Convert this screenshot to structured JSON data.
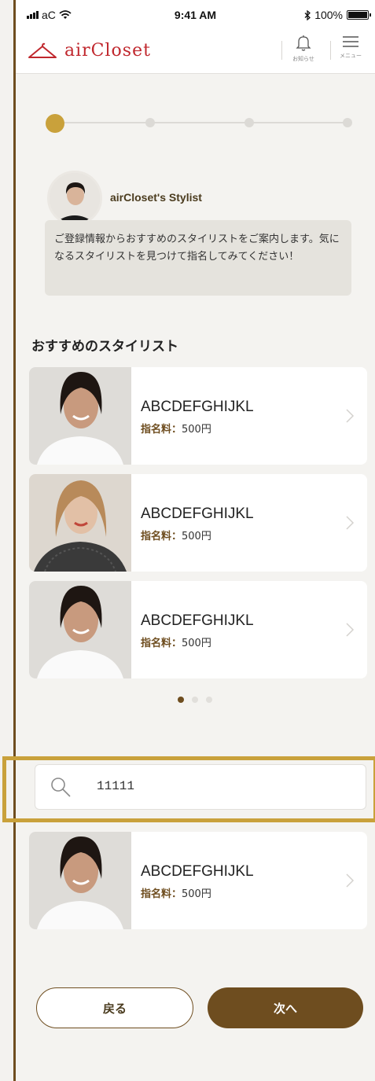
{
  "status_bar": {
    "carrier": "aC",
    "time": "9:41 AM",
    "battery": "100%"
  },
  "header": {
    "logo_text": "airCloset",
    "notifications_label": "お知らせ",
    "menu_label": "メニュー"
  },
  "progress": {
    "current_step": 1,
    "total_steps": 4
  },
  "stylist_intro": {
    "name": "airCloset's Stylist",
    "message": "ご登録情報からおすすめのスタイリストをご案内します。気になるスタイリストを見つけて指名してみてください！"
  },
  "recommended": {
    "title": "おすすめのスタイリスト",
    "stylists": [
      {
        "name": "ABCDEFGHIJKL",
        "fee_label": "指名料：",
        "fee_value": "500円"
      },
      {
        "name": "ABCDEFGHIJKL",
        "fee_label": "指名料：",
        "fee_value": "500円"
      },
      {
        "name": "ABCDEFGHIJKL",
        "fee_label": "指名料：",
        "fee_value": "500円"
      }
    ],
    "pager": {
      "current": 1,
      "total": 3
    }
  },
  "search": {
    "value": "11111"
  },
  "result": {
    "name": "ABCDEFGHIJKL",
    "fee_label": "指名料：",
    "fee_value": "500円"
  },
  "buttons": {
    "back": "戻る",
    "next": "次へ"
  },
  "colors": {
    "brand_red": "#c0272d",
    "accent_gold": "#c9a13b",
    "primary_brown": "#6e4d1f"
  }
}
